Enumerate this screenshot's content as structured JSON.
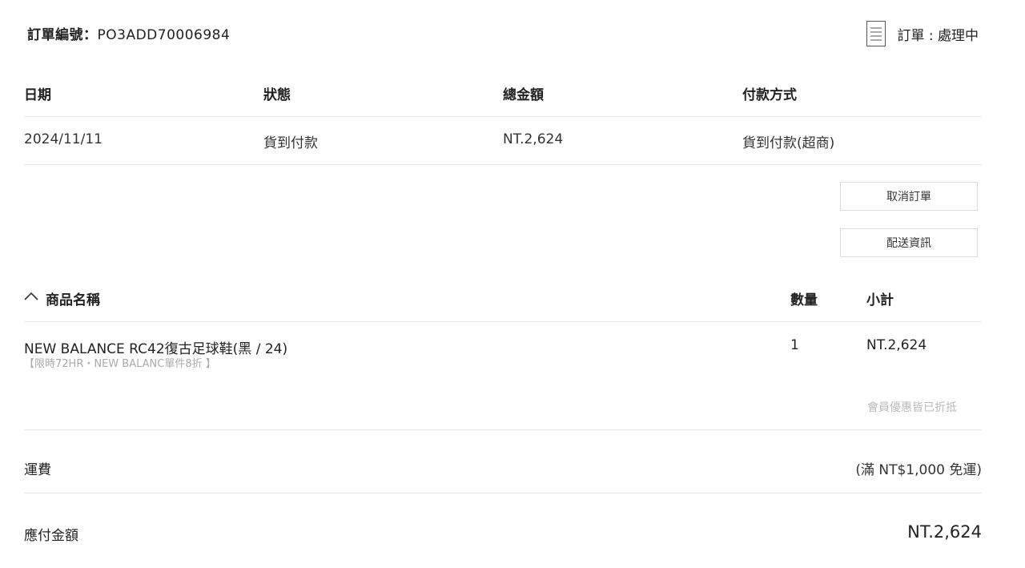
{
  "order": {
    "number_label": "訂單編號：",
    "number_value": "PO3ADD70006984",
    "status_text": "訂單 : 處理中"
  },
  "summary": {
    "headers": [
      "日期",
      "狀態",
      "總金額",
      "付款方式"
    ],
    "values": [
      "2024/11/11",
      "貨到付款",
      "NT.2,624",
      "貨到付款(超商)"
    ]
  },
  "actions": {
    "cancel_label": "取消訂單",
    "shipping_info_label": "配送資訊"
  },
  "products": {
    "header_name": "商品名稱",
    "header_qty": "數量",
    "header_subtotal": "小計",
    "items": [
      {
        "title": "NEW BALANCE RC42復古足球鞋(黑 / 24)",
        "promo": "【限時72HR・NEW BALANC單件8折 】",
        "qty": "1",
        "subtotal": "NT.2,624"
      }
    ],
    "member_note": "會員優惠皆已折抵"
  },
  "shipping": {
    "label": "運費",
    "value": "(滿 NT$1,000 免運)"
  },
  "total": {
    "label": "應付金額",
    "value": "NT.2,624"
  },
  "icons": {
    "status": "document-icon",
    "collapse": "chevron-up-icon"
  }
}
